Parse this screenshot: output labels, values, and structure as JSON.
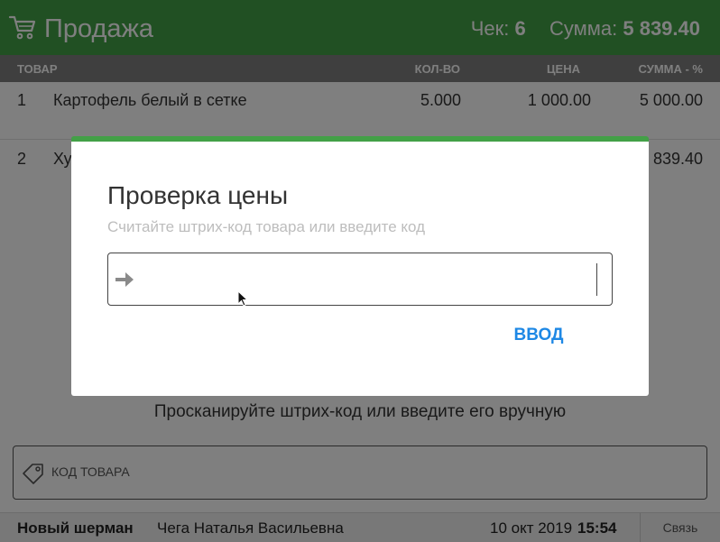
{
  "header": {
    "title": "Продажа",
    "check_label": "Чек:",
    "check_value": "6",
    "sum_label": "Сумма:",
    "sum_value": "5 839.40",
    "icon": "cart-icon",
    "color": "#43a047"
  },
  "table": {
    "columns": [
      "ТОВАР",
      "КОЛ-ВО",
      "ЦЕНА",
      "СУММА - %"
    ],
    "rows": [
      {
        "num": "1",
        "name": "Картофель белый в сетке",
        "qty": "5.000",
        "price": "1 000.00",
        "sum": "5 000.00"
      },
      {
        "num": "2",
        "name": "Ху",
        "qty": "",
        "price": "",
        "sum": "839.40"
      }
    ]
  },
  "scan_hint": "Просканируйте штрих-код или введите его вручную",
  "code_input": {
    "placeholder": "КОД ТОВАРА",
    "icon": "tag-icon"
  },
  "footer": {
    "store": "Новый шерман",
    "user": "Чега Наталья Васильевна",
    "date": "10 окт 2019",
    "time": "15:54",
    "link": "Связь"
  },
  "modal": {
    "title": "Проверка цены",
    "subtitle": "Считайте штрих-код товара или введите код",
    "input_value": "",
    "input_icon": "arrow-right-icon",
    "enter_label": "ВВОД",
    "accent": "#1e88e5"
  }
}
